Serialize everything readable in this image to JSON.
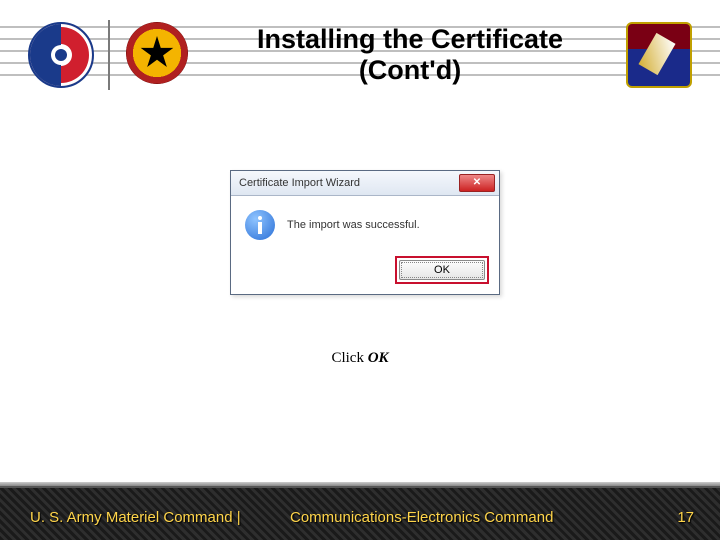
{
  "header": {
    "title": "Installing the Certificate (Cont'd)"
  },
  "dialog": {
    "title": "Certificate Import Wizard",
    "close_glyph": "✕",
    "message": "The import was successful.",
    "ok_label": "OK"
  },
  "caption": {
    "prefix": "Click ",
    "action": "OK"
  },
  "footer": {
    "left": "U. S. Army Materiel Command",
    "separator": "  |  ",
    "mid": "Communications-Electronics Command",
    "page": "17"
  }
}
